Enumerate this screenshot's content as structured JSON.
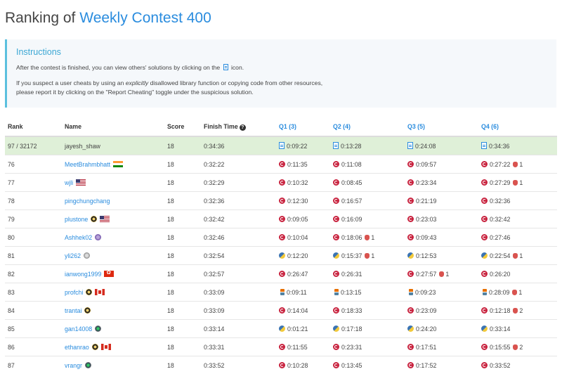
{
  "header": {
    "title_prefix": "Ranking of",
    "contest_name": "Weekly Contest 400"
  },
  "instructions": {
    "title": "Instructions",
    "line1_before": "After the contest is finished, you can view others' solutions by clicking on the",
    "line1_after": "icon.",
    "line2_a": "If you suspect a user cheats by using an",
    "line2_em": "explicitly",
    "line2_b": "disallowed library function or copying code from other resources,",
    "line3": "please report it by clicking on the \"Report Cheating\" toggle under the suspicious solution."
  },
  "table": {
    "headers": {
      "rank": "Rank",
      "name": "Name",
      "score": "Score",
      "finish_time": "Finish Time",
      "q1": "Q1 (3)",
      "q2": "Q2 (4)",
      "q3": "Q3 (5)",
      "q4": "Q4 (6)"
    },
    "rows": [
      {
        "rank": "97 / 32172",
        "name": "jayesh_shaw",
        "score": "18",
        "finish": "0:34:36",
        "self": true,
        "badge": "",
        "flag": "",
        "q": [
          {
            "lang": "doc",
            "time": "0:09:22",
            "bugs": ""
          },
          {
            "lang": "doc",
            "time": "0:13:28",
            "bugs": ""
          },
          {
            "lang": "doc",
            "time": "0:24:08",
            "bugs": ""
          },
          {
            "lang": "doc",
            "time": "0:34:36",
            "bugs": ""
          }
        ]
      },
      {
        "rank": "76",
        "name": "MeetBrahmbhatt",
        "score": "18",
        "finish": "0:32:22",
        "badge": "",
        "flag": "in",
        "q": [
          {
            "lang": "cpp",
            "time": "0:11:35",
            "bugs": ""
          },
          {
            "lang": "cpp",
            "time": "0:11:08",
            "bugs": ""
          },
          {
            "lang": "cpp",
            "time": "0:09:57",
            "bugs": ""
          },
          {
            "lang": "cpp",
            "time": "0:27:22",
            "bugs": "1"
          }
        ]
      },
      {
        "rank": "77",
        "name": "wjli",
        "score": "18",
        "finish": "0:32:29",
        "badge": "",
        "flag": "us",
        "q": [
          {
            "lang": "cpp",
            "time": "0:10:32",
            "bugs": ""
          },
          {
            "lang": "cpp",
            "time": "0:08:45",
            "bugs": ""
          },
          {
            "lang": "cpp",
            "time": "0:23:34",
            "bugs": ""
          },
          {
            "lang": "cpp",
            "time": "0:27:29",
            "bugs": "1"
          }
        ]
      },
      {
        "rank": "78",
        "name": "pingchungchang",
        "score": "18",
        "finish": "0:32:36",
        "badge": "",
        "flag": "",
        "q": [
          {
            "lang": "cpp",
            "time": "0:12:30",
            "bugs": ""
          },
          {
            "lang": "cpp",
            "time": "0:16:57",
            "bugs": ""
          },
          {
            "lang": "cpp",
            "time": "0:21:19",
            "bugs": ""
          },
          {
            "lang": "cpp",
            "time": "0:32:36",
            "bugs": ""
          }
        ]
      },
      {
        "rank": "79",
        "name": "plustone",
        "score": "18",
        "finish": "0:32:42",
        "badge": "gold",
        "flag": "us",
        "q": [
          {
            "lang": "cpp",
            "time": "0:09:05",
            "bugs": ""
          },
          {
            "lang": "cpp",
            "time": "0:16:09",
            "bugs": ""
          },
          {
            "lang": "cpp",
            "time": "0:23:03",
            "bugs": ""
          },
          {
            "lang": "cpp",
            "time": "0:32:42",
            "bugs": ""
          }
        ]
      },
      {
        "rank": "80",
        "name": "Ashhek02",
        "score": "18",
        "finish": "0:32:46",
        "badge": "purple",
        "flag": "",
        "q": [
          {
            "lang": "cpp",
            "time": "0:10:04",
            "bugs": ""
          },
          {
            "lang": "cpp",
            "time": "0:18:06",
            "bugs": "1"
          },
          {
            "lang": "cpp",
            "time": "0:09:43",
            "bugs": ""
          },
          {
            "lang": "cpp",
            "time": "0:27:46",
            "bugs": ""
          }
        ]
      },
      {
        "rank": "81",
        "name": "yli262",
        "score": "18",
        "finish": "0:32:54",
        "badge": "grey",
        "flag": "",
        "q": [
          {
            "lang": "python",
            "time": "0:12:20",
            "bugs": ""
          },
          {
            "lang": "python",
            "time": "0:15:37",
            "bugs": "1"
          },
          {
            "lang": "python",
            "time": "0:12:53",
            "bugs": ""
          },
          {
            "lang": "python",
            "time": "0:22:54",
            "bugs": "1"
          }
        ]
      },
      {
        "rank": "82",
        "name": "ianwong1999",
        "score": "18",
        "finish": "0:32:57",
        "badge": "",
        "flag": "hk",
        "q": [
          {
            "lang": "cpp",
            "time": "0:26:47",
            "bugs": ""
          },
          {
            "lang": "cpp",
            "time": "0:26:31",
            "bugs": ""
          },
          {
            "lang": "cpp",
            "time": "0:27:57",
            "bugs": "1"
          },
          {
            "lang": "cpp",
            "time": "0:26:20",
            "bugs": ""
          }
        ]
      },
      {
        "rank": "83",
        "name": "profchi",
        "score": "18",
        "finish": "0:33:09",
        "badge": "gold",
        "flag": "ca",
        "q": [
          {
            "lang": "java",
            "time": "0:09:11",
            "bugs": ""
          },
          {
            "lang": "java",
            "time": "0:13:15",
            "bugs": ""
          },
          {
            "lang": "java",
            "time": "0:09:23",
            "bugs": ""
          },
          {
            "lang": "java",
            "time": "0:28:09",
            "bugs": "1"
          }
        ]
      },
      {
        "rank": "84",
        "name": "trantai",
        "score": "18",
        "finish": "0:33:09",
        "badge": "gold",
        "flag": "",
        "q": [
          {
            "lang": "cpp",
            "time": "0:14:04",
            "bugs": ""
          },
          {
            "lang": "cpp",
            "time": "0:18:33",
            "bugs": ""
          },
          {
            "lang": "cpp",
            "time": "0:23:09",
            "bugs": ""
          },
          {
            "lang": "cpp",
            "time": "0:12:18",
            "bugs": "2"
          }
        ]
      },
      {
        "rank": "85",
        "name": "gan14008",
        "score": "18",
        "finish": "0:33:14",
        "badge": "guardian",
        "flag": "",
        "q": [
          {
            "lang": "python",
            "time": "0:01:21",
            "bugs": ""
          },
          {
            "lang": "python",
            "time": "0:17:18",
            "bugs": ""
          },
          {
            "lang": "python",
            "time": "0:24:20",
            "bugs": ""
          },
          {
            "lang": "python",
            "time": "0:33:14",
            "bugs": ""
          }
        ]
      },
      {
        "rank": "86",
        "name": "ethanrao",
        "score": "18",
        "finish": "0:33:31",
        "badge": "gold",
        "flag": "ca",
        "q": [
          {
            "lang": "cpp",
            "time": "0:11:55",
            "bugs": ""
          },
          {
            "lang": "cpp",
            "time": "0:23:31",
            "bugs": ""
          },
          {
            "lang": "cpp",
            "time": "0:17:51",
            "bugs": ""
          },
          {
            "lang": "cpp",
            "time": "0:15:55",
            "bugs": "2"
          }
        ]
      },
      {
        "rank": "87",
        "name": "vrangr",
        "score": "18",
        "finish": "0:33:52",
        "badge": "guardian",
        "flag": "",
        "q": [
          {
            "lang": "cpp",
            "time": "0:10:28",
            "bugs": ""
          },
          {
            "lang": "cpp",
            "time": "0:13:45",
            "bugs": ""
          },
          {
            "lang": "cpp",
            "time": "0:17:52",
            "bugs": ""
          },
          {
            "lang": "cpp",
            "time": "0:33:52",
            "bugs": ""
          }
        ]
      }
    ]
  }
}
